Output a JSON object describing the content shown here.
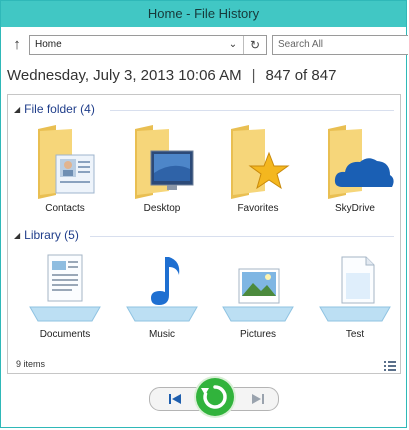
{
  "window": {
    "title": "Home - File History"
  },
  "toolbar": {
    "address": "Home",
    "search_placeholder": "Search All"
  },
  "snapshot": {
    "date": "Wednesday, July 3, 2013 10:06 AM",
    "separator": "|",
    "position": "847 of 847"
  },
  "groups": {
    "folders": {
      "header": "File folder (4)",
      "items": [
        {
          "label": "Contacts",
          "icon": "contacts-folder-icon"
        },
        {
          "label": "Desktop",
          "icon": "desktop-folder-icon"
        },
        {
          "label": "Favorites",
          "icon": "favorites-folder-icon"
        },
        {
          "label": "SkyDrive",
          "icon": "skydrive-folder-icon"
        }
      ]
    },
    "libraries": {
      "header": "Library (5)",
      "items": [
        {
          "label": "Documents",
          "icon": "documents-library-icon"
        },
        {
          "label": "Music",
          "icon": "music-library-icon"
        },
        {
          "label": "Pictures",
          "icon": "pictures-library-icon"
        },
        {
          "label": "Test",
          "icon": "test-library-icon"
        }
      ]
    }
  },
  "status": {
    "items": "9 items"
  },
  "colors": {
    "titlebar": "#41c7c4",
    "group_header": "#1f3d8a",
    "restore_button": "#31b33c",
    "folder": "#f2cf6b"
  }
}
